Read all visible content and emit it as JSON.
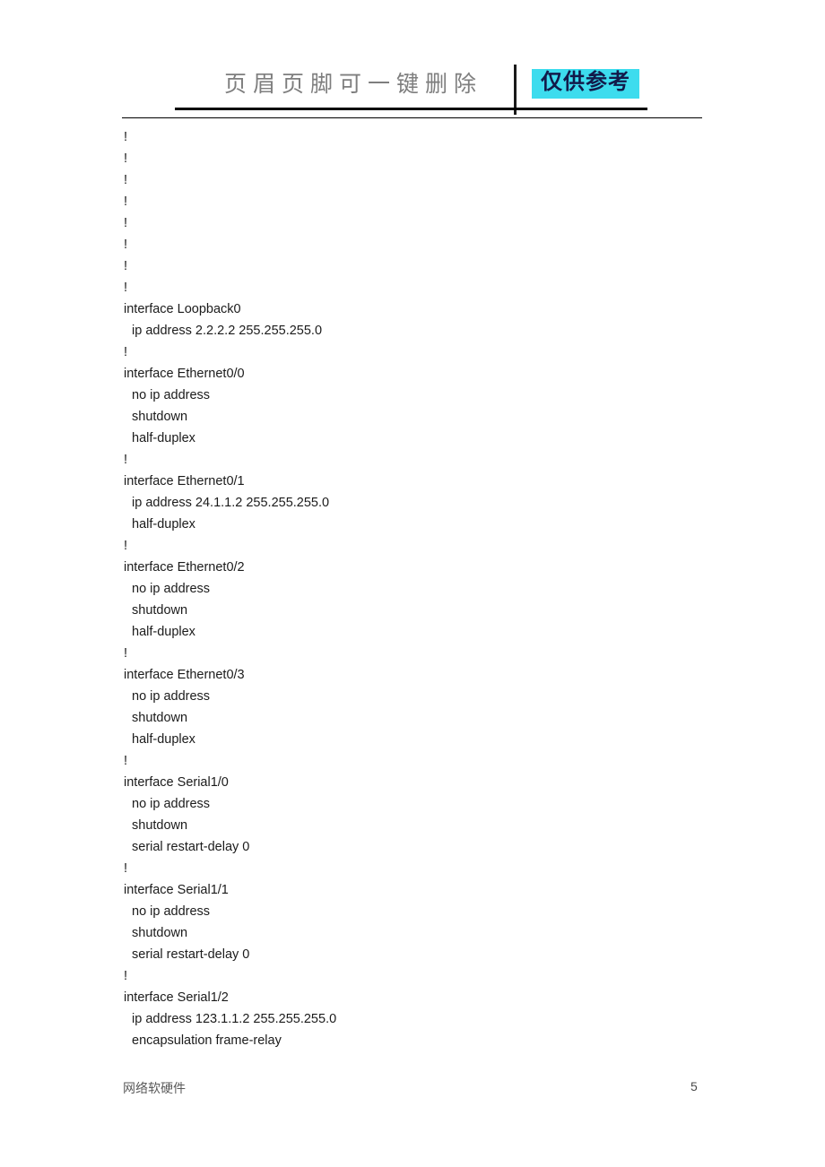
{
  "header": {
    "watermark_text": "页眉页脚可一键删除",
    "stamp_text": "仅供参考",
    "stamp_bg_color": "#3ddcee",
    "stamp_text_color": "#121a4a",
    "watermark_color": "#7e7e7e",
    "rule_color": "#000000"
  },
  "document": {
    "lines": [
      {
        "text": "!",
        "indent": false
      },
      {
        "text": "!",
        "indent": false
      },
      {
        "text": "!",
        "indent": false
      },
      {
        "text": "!",
        "indent": false
      },
      {
        "text": "!",
        "indent": false
      },
      {
        "text": "!",
        "indent": false
      },
      {
        "text": "!",
        "indent": false
      },
      {
        "text": "!",
        "indent": false
      },
      {
        "text": "interface Loopback0",
        "indent": false
      },
      {
        "text": "ip address 2.2.2.2 255.255.255.0",
        "indent": true
      },
      {
        "text": "!",
        "indent": false
      },
      {
        "text": "interface Ethernet0/0",
        "indent": false
      },
      {
        "text": "no ip address",
        "indent": true
      },
      {
        "text": "shutdown",
        "indent": true
      },
      {
        "text": "half-duplex",
        "indent": true
      },
      {
        "text": "!",
        "indent": false
      },
      {
        "text": "interface Ethernet0/1",
        "indent": false
      },
      {
        "text": "ip address 24.1.1.2 255.255.255.0",
        "indent": true
      },
      {
        "text": "half-duplex",
        "indent": true
      },
      {
        "text": "!",
        "indent": false
      },
      {
        "text": "interface Ethernet0/2",
        "indent": false
      },
      {
        "text": "no ip address",
        "indent": true
      },
      {
        "text": "shutdown",
        "indent": true
      },
      {
        "text": "half-duplex",
        "indent": true
      },
      {
        "text": "!",
        "indent": false
      },
      {
        "text": "interface Ethernet0/3",
        "indent": false
      },
      {
        "text": "no ip address",
        "indent": true
      },
      {
        "text": "shutdown",
        "indent": true
      },
      {
        "text": "half-duplex",
        "indent": true
      },
      {
        "text": "!",
        "indent": false
      },
      {
        "text": "interface Serial1/0",
        "indent": false
      },
      {
        "text": "no ip address",
        "indent": true
      },
      {
        "text": "shutdown",
        "indent": true
      },
      {
        "text": "serial restart-delay 0",
        "indent": true
      },
      {
        "text": "!",
        "indent": false
      },
      {
        "text": "interface Serial1/1",
        "indent": false
      },
      {
        "text": "no ip address",
        "indent": true
      },
      {
        "text": "shutdown",
        "indent": true
      },
      {
        "text": "serial restart-delay 0",
        "indent": true
      },
      {
        "text": "!",
        "indent": false
      },
      {
        "text": "interface Serial1/2",
        "indent": false
      },
      {
        "text": "ip address 123.1.1.2 255.255.255.0",
        "indent": true
      },
      {
        "text": "encapsulation frame-relay",
        "indent": true
      }
    ]
  },
  "footer": {
    "left_text": "网络软硬件",
    "page_number": "5"
  }
}
